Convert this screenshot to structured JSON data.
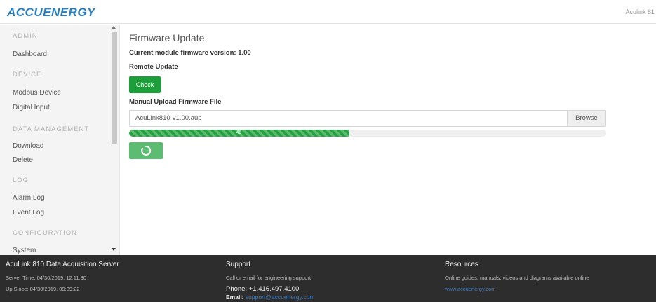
{
  "header": {
    "logo_text": "ACCUENERGY",
    "user_text": "Aculink 81"
  },
  "sidebar": {
    "sections": [
      {
        "label": "ADMIN",
        "items": [
          "Dashboard"
        ]
      },
      {
        "label": "DEVICE",
        "items": [
          "Modbus Device",
          "Digital Input"
        ]
      },
      {
        "label": "DATA MANAGEMENT",
        "items": [
          "Download",
          "Delete"
        ]
      },
      {
        "label": "LOG",
        "items": [
          "Alarm Log",
          "Event Log"
        ]
      },
      {
        "label": "CONFIGURATION",
        "items": [
          "System"
        ]
      }
    ]
  },
  "main": {
    "title": "Firmware Update",
    "fw_label": "Current module firmware version:",
    "fw_version": "1.00",
    "remote_label": "Remote Update",
    "check_label": "Check",
    "manual_label": "Manual Upload Firmware File",
    "file_value": "AcuLink810-v1.00.aup",
    "browse_label": "Browse",
    "progress_value": 46,
    "progress_text": "46"
  },
  "footer": {
    "col1": {
      "title": "AcuLink 810 Data Acquisition Server",
      "server_time": "Server Time: 04/30/2019, 12:11:30",
      "up_since": "Up Since: 04/30/2019, 09:09:22"
    },
    "col2": {
      "title": "Support",
      "desc": "Call or email for engineering support",
      "phone": "Phone: +1.416.497.4100",
      "email_label": "Email:",
      "email": "support@accuenergy.com"
    },
    "col3": {
      "title": "Resources",
      "desc": "Online guides, manuals, videos and diagrams available online",
      "link": "www.accuenergy.com"
    }
  },
  "colors": {
    "accent": "#2a7fc1",
    "success": "#1e9e3b",
    "footer_bg": "#2d2d2d"
  }
}
